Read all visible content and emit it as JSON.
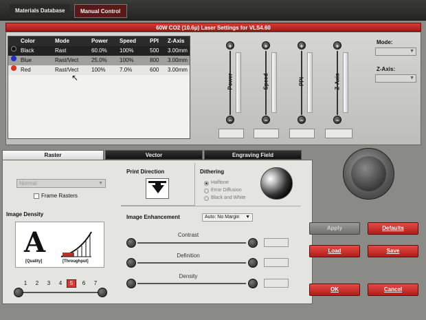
{
  "top_tabs": {
    "materials_database": "Materials Database",
    "manual_control": "Manual Control"
  },
  "settings_title": "60W CO2 (10.6μ) Laser Settings for VLS4.60",
  "color_table": {
    "headers": [
      "Color",
      "Mode",
      "Power",
      "Speed",
      "PPI",
      "Z-Axis"
    ],
    "rows": [
      {
        "color": "Black",
        "dot": "#111111",
        "mode": "Rast",
        "power": "60.0%",
        "speed": "100%",
        "ppi": "500",
        "z_axis": "3.00mm"
      },
      {
        "color": "Blue",
        "dot": "#2030d0",
        "mode": "Rast/Vect",
        "power": "25.0%",
        "speed": "100%",
        "ppi": "800",
        "z_axis": "3.00mm"
      },
      {
        "color": "Red",
        "dot": "#e03020",
        "mode": "Rast/Vect",
        "power": "100%",
        "speed": "7.0%",
        "ppi": "600",
        "z_axis": "3.00mm"
      }
    ]
  },
  "sliders": {
    "power": "Power",
    "speed": "Speed",
    "ppi": "PPI",
    "z_axis": "Z-Axis",
    "plus": "+",
    "minus": "−"
  },
  "side_controls": {
    "mode_label": "Mode:",
    "z_axis_label": "Z-Axis:"
  },
  "lower_tabs": {
    "raster": "Raster",
    "vector": "Vector",
    "engraving_field": "Engraving Field"
  },
  "raster": {
    "mode_select": "Normal",
    "frame_rasters": "Frame Rasters",
    "image_density": "Image Density",
    "quality_glyph": "A",
    "quality": "[Quality]",
    "throughput": "[Throughput]",
    "density_levels": [
      "1",
      "2",
      "3",
      "4",
      "5",
      "6",
      "7"
    ],
    "selected_density": "5"
  },
  "print_direction": {
    "label": "Print Direction"
  },
  "dithering": {
    "label": "Dithering",
    "options": [
      "Halftone",
      "Error Diffusion",
      "Black and White"
    ],
    "selected": "Halftone"
  },
  "image_enhancement": {
    "label": "Image Enhancement",
    "margin_select": "Auto: No Margin",
    "contrast": "Contrast",
    "definition": "Definition",
    "density": "Density"
  },
  "buttons": {
    "apply": "Apply",
    "defaults": "Defaults",
    "load": "Load",
    "save": "Save",
    "ok": "OK",
    "cancel": "Cancel"
  },
  "colors": {
    "accent_red": "#d63a34",
    "dark_header": "#2b2b2b"
  }
}
